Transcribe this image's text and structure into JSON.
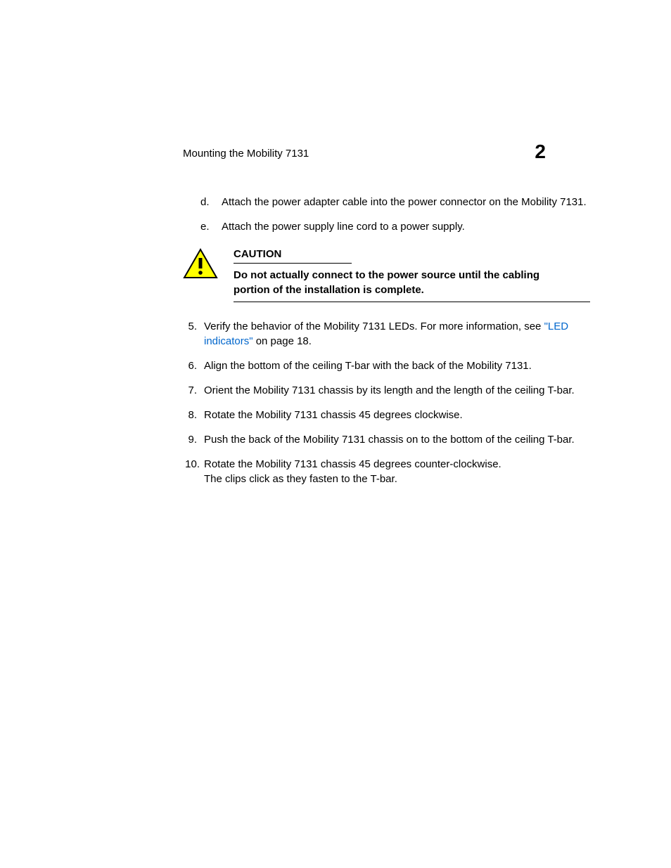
{
  "header": {
    "title": "Mounting the Mobility 7131",
    "chapter": "2"
  },
  "sublist": {
    "d": {
      "marker": "d.",
      "text": "Attach the power adapter cable into the power connector on the Mobility 7131."
    },
    "e": {
      "marker": "e.",
      "text": "Attach the power supply line cord to a power supply."
    }
  },
  "caution": {
    "label": "CAUTION",
    "text": "Do not actually connect to the power source until the cabling portion of the installation is complete."
  },
  "mainlist": {
    "item5": {
      "marker": "5.",
      "text_before": "Verify the behavior of the Mobility 7131 LEDs. For more information, see ",
      "link": "\"LED indicators\"",
      "text_after": " on page 18."
    },
    "item6": {
      "marker": "6.",
      "text": "Align the bottom of the ceiling T-bar with the back of the Mobility 7131."
    },
    "item7": {
      "marker": "7.",
      "text": "Orient the Mobility 7131 chassis by its length and the length of the ceiling T-bar."
    },
    "item8": {
      "marker": "8.",
      "text": "Rotate the Mobility 7131 chassis 45 degrees clockwise."
    },
    "item9": {
      "marker": "9.",
      "text": "Push the back of the Mobility 7131 chassis on to the bottom of the ceiling T-bar."
    },
    "item10": {
      "marker": "10.",
      "line1": "Rotate the Mobility 7131 chassis 45 degrees counter-clockwise.",
      "line2": "The clips click as they fasten to the T-bar."
    }
  }
}
